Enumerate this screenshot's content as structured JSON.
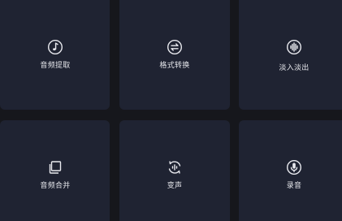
{
  "tools": [
    {
      "label": "音频提取",
      "icon": "music-note-icon"
    },
    {
      "label": "格式转换",
      "icon": "convert-arrows-icon"
    },
    {
      "label": "淡入淡出",
      "icon": "waveform-icon"
    },
    {
      "label": "音频合并",
      "icon": "stacked-pages-icon"
    },
    {
      "label": "变声",
      "icon": "voice-change-icon"
    },
    {
      "label": "录音",
      "icon": "microphone-icon"
    }
  ],
  "colors": {
    "background": "#16171c",
    "tile": "#1f2332",
    "text": "#e4e5ea"
  }
}
